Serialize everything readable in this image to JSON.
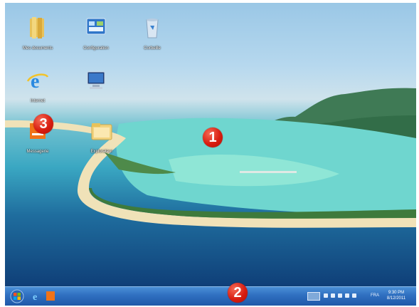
{
  "desktop": {
    "icons": [
      {
        "label": "Mes documents",
        "icon": "folder-icon"
      },
      {
        "label": "Configuration",
        "icon": "control-panel-icon"
      },
      {
        "label": "Corbeille",
        "icon": "recycle-bin-icon"
      },
      {
        "label": "Internet",
        "icon": "internet-explorer-icon"
      },
      {
        "label": "",
        "icon": "computer-icon"
      },
      {
        "label": "Messagerie",
        "icon": "mail-app-icon"
      },
      {
        "label": "Explorateur",
        "icon": "explorer-folder-icon"
      }
    ]
  },
  "taskbar": {
    "start_icon": "windows-logo-icon",
    "pinned": [
      "internet-explorer-icon",
      "orange-app-icon"
    ],
    "tray": {
      "language": "FRA",
      "time": "9:30 PM",
      "date": "8/12/2011"
    }
  },
  "callouts": [
    "1",
    "2",
    "3"
  ],
  "colors": {
    "taskbar": "#2f6fc0",
    "callout": "#d81d10",
    "lagoon": "#6fd6cf",
    "ocean": "#1f6d9e"
  }
}
